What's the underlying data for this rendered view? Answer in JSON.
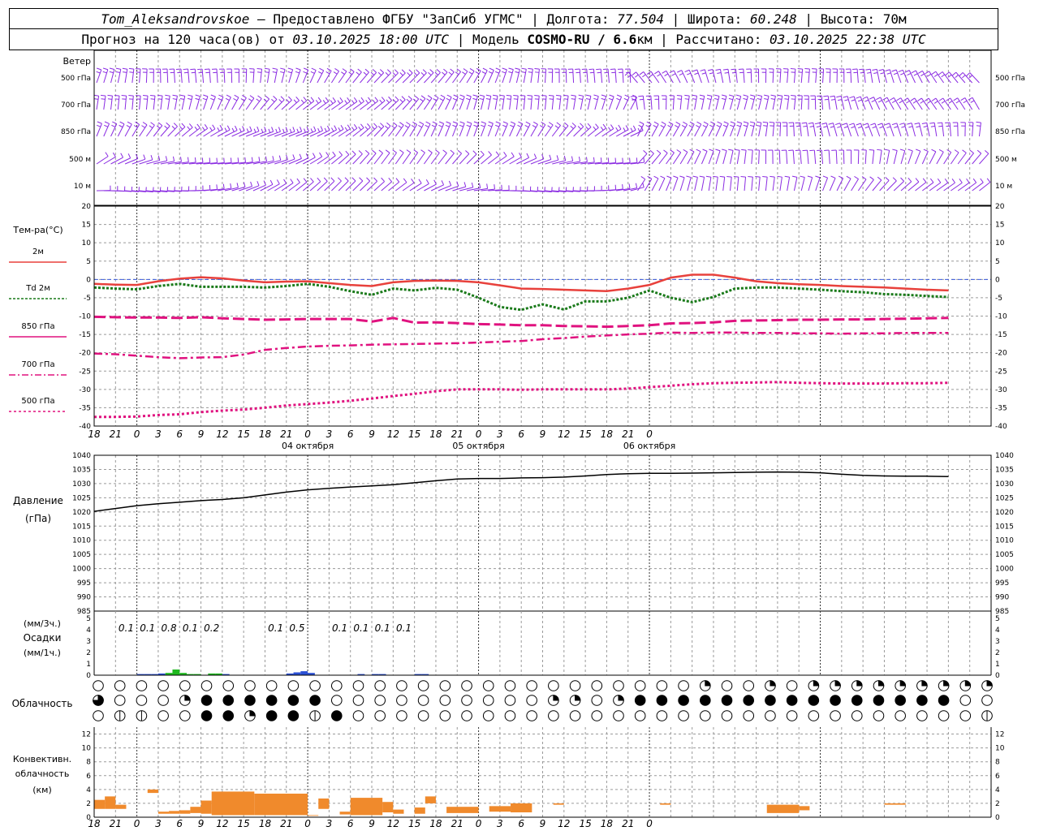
{
  "header": {
    "station": "Tom_Aleksandrovskoe",
    "provided_label": " — Предоставлено ФГБУ \"ЗапСиб УГМС\" | Долгота: ",
    "lon": "77.504",
    "lat_label": " | Широта: ",
    "lat": "60.248",
    "alt_label": " | Высота: 70м",
    "forecast_label": "Прогноз на 120 часа(ов) от ",
    "start": "03.10.2025 18:00 UTC",
    "model_label": " | Модель ",
    "model": "COSMO-RU / 6.6",
    "model_unit": "км",
    "calc_label": " | Рассчитано: ",
    "calc": "03.10.2025 22:38 UTC"
  },
  "chart_data": {
    "type": "meteogram",
    "hours": [
      0,
      3,
      6,
      9,
      12,
      15,
      18,
      21,
      24,
      27,
      30,
      33,
      36,
      39,
      42,
      45,
      48,
      51,
      54,
      57,
      60,
      63,
      66,
      69,
      72,
      75,
      78,
      81,
      84,
      87,
      90,
      93,
      96,
      99,
      102,
      105,
      108,
      111,
      114,
      117,
      120
    ],
    "time_ticks": [
      "18",
      "21",
      "0",
      "3",
      "6",
      "9",
      "12",
      "15",
      "18",
      "21",
      "0",
      "3",
      "6",
      "9",
      "12",
      "15",
      "18",
      "21",
      "0",
      "3",
      "6",
      "9",
      "12",
      "15",
      "18",
      "21",
      "0"
    ],
    "dates": [
      "04 октября",
      "05 октября",
      "06 октября"
    ],
    "colors": {
      "t2m": "#e8413c",
      "td": "#1a7a1a",
      "t850": "#e0127f",
      "t700": "#e0127f",
      "t500": "#e0127f",
      "wind": "#8a2be2",
      "pressure": "#000000",
      "precip_rain": "#2a4fd4",
      "precip_snow": "#1fb81f",
      "conv": "#f08a2c",
      "grid": "#9a9a9a"
    },
    "wind": {
      "label": "Ветер",
      "levels": [
        "500 гПа",
        "700 гПа",
        "850 гПа",
        "500 м",
        "10  м"
      ]
    },
    "temperature": {
      "ylabel": "Тем-ра(°C)",
      "ylim": [
        -40,
        20
      ],
      "yticks": [
        20,
        15,
        10,
        5,
        0,
        -5,
        -10,
        -15,
        -20,
        -25,
        -30,
        -35,
        -40
      ],
      "legend": [
        "2м",
        "Td  2м",
        "850 гПа",
        "700 гПа",
        "500 гПа"
      ],
      "t2m": [
        -1.2,
        -1.4,
        -1.5,
        -0.5,
        0.2,
        0.6,
        0.3,
        -0.3,
        -0.8,
        -0.6,
        -0.5,
        -1,
        -1.5,
        -1.8,
        -0.8,
        -0.4,
        -0.3,
        -0.4,
        -0.8,
        -1.6,
        -2.5,
        -2.6,
        -2.8,
        -3,
        -3.2,
        -2.5,
        -1.5,
        0.5,
        1.3,
        1.3,
        0.5,
        -0.5,
        -1,
        -1.3,
        -1.5,
        -1.8,
        -2,
        -2.2,
        -2.5,
        -2.8,
        -3
      ],
      "td": [
        -2.2,
        -2.5,
        -2.7,
        -1.8,
        -1.2,
        -2,
        -2,
        -2,
        -2.2,
        -1.8,
        -1.2,
        -2,
        -3.2,
        -4.2,
        -2.5,
        -3,
        -2.3,
        -2.8,
        -5,
        -7.5,
        -8.3,
        -6.8,
        -8.2,
        -6,
        -6,
        -5,
        -3,
        -5,
        -6.2,
        -4.8,
        -2.5,
        -2.2,
        -2.2,
        -2.5,
        -2.8,
        -3.2,
        -3.5,
        -4,
        -4.2,
        -4.5,
        -4.8
      ],
      "t850": [
        -10.2,
        -10.3,
        -10.4,
        -10.4,
        -10.5,
        -10.3,
        -10.6,
        -10.8,
        -11,
        -10.9,
        -10.8,
        -10.8,
        -10.8,
        -11.5,
        -10.5,
        -11.8,
        -11.7,
        -11.9,
        -12.2,
        -12.3,
        -12.5,
        -12.5,
        -12.7,
        -12.8,
        -12.9,
        -12.7,
        -12.5,
        -12,
        -11.9,
        -11.7,
        -11.3,
        -11.2,
        -11.1,
        -11,
        -11,
        -10.9,
        -10.9,
        -10.8,
        -10.7,
        -10.6,
        -10.5
      ],
      "t700": [
        -20.2,
        -20.4,
        -20.8,
        -21.2,
        -21.5,
        -21.3,
        -21.2,
        -20.5,
        -19.2,
        -18.7,
        -18.3,
        -18.1,
        -18,
        -17.8,
        -17.7,
        -17.6,
        -17.5,
        -17.4,
        -17.2,
        -17,
        -16.8,
        -16.3,
        -16,
        -15.6,
        -15.3,
        -15,
        -14.8,
        -14.5,
        -14.6,
        -14.5,
        -14.5,
        -14.6,
        -14.6,
        -14.7,
        -14.7,
        -14.8,
        -14.7,
        -14.7,
        -14.6,
        -14.6,
        -14.6
      ],
      "t500": [
        -37.5,
        -37.5,
        -37.4,
        -37,
        -36.8,
        -36.2,
        -35.8,
        -35.5,
        -35,
        -34.4,
        -34,
        -33.6,
        -33.1,
        -32.5,
        -31.8,
        -31.2,
        -30.5,
        -30,
        -30,
        -30,
        -30.1,
        -30,
        -30,
        -30,
        -30,
        -29.8,
        -29.4,
        -29,
        -28.6,
        -28.3,
        -28.2,
        -28.1,
        -28,
        -28.2,
        -28.3,
        -28.4,
        -28.4,
        -28.4,
        -28.3,
        -28.3,
        -28.2
      ]
    },
    "pressure": {
      "ylabel": [
        "Давление",
        "(гПа)"
      ],
      "ylim": [
        985,
        1040
      ],
      "yticks": [
        1040,
        1035,
        1030,
        1025,
        1020,
        1015,
        1010,
        1005,
        1000,
        995,
        990,
        985
      ],
      "values": [
        1020.2,
        1021.2,
        1022.2,
        1022.9,
        1023.4,
        1024,
        1024.4,
        1025,
        1026,
        1027,
        1027.8,
        1028.3,
        1028.8,
        1029.2,
        1029.6,
        1030.3,
        1031,
        1031.6,
        1031.8,
        1031.8,
        1032,
        1032.1,
        1032.3,
        1032.7,
        1033.2,
        1033.5,
        1033.6,
        1033.6,
        1033.7,
        1033.8,
        1033.9,
        1034,
        1034.1,
        1034,
        1033.8,
        1033.3,
        1032.9,
        1032.7,
        1032.6,
        1032.6,
        1032.5
      ]
    },
    "precipitation": {
      "ylabel": [
        "(мм/3ч.)",
        "Осадки",
        "(мм/1ч.)"
      ],
      "ylim": [
        0,
        5
      ],
      "yticks": [
        5,
        4,
        3,
        2,
        1,
        0
      ],
      "labels": [
        [
          "0.1",
          6
        ],
        [
          "0.1",
          9
        ],
        [
          "0.8",
          12
        ],
        [
          "0.1",
          15
        ],
        [
          "0.2",
          18
        ],
        [
          "0.1",
          27
        ],
        [
          "0.5",
          30
        ],
        [
          "0.1",
          36
        ],
        [
          "0.1",
          39
        ],
        [
          "0.1",
          42
        ],
        [
          "0.1",
          45
        ]
      ],
      "bars": [
        [
          6,
          0.1,
          "rain"
        ],
        [
          7,
          0.1,
          "rain"
        ],
        [
          8,
          0.1,
          "rain"
        ],
        [
          9,
          0.15,
          "rain"
        ],
        [
          10,
          0.2,
          "snow"
        ],
        [
          11,
          0.5,
          "snow"
        ],
        [
          12,
          0.2,
          "snow"
        ],
        [
          13,
          0.1,
          "snow"
        ],
        [
          14,
          0.1,
          "snow"
        ],
        [
          16,
          0.15,
          "snow"
        ],
        [
          17,
          0.15,
          "snow"
        ],
        [
          18,
          0.1,
          "rain"
        ],
        [
          27,
          0.15,
          "rain"
        ],
        [
          28,
          0.25,
          "rain"
        ],
        [
          29,
          0.35,
          "rain"
        ],
        [
          30,
          0.2,
          "rain"
        ],
        [
          37,
          0.1,
          "rain"
        ],
        [
          39,
          0.1,
          "rain"
        ],
        [
          40,
          0.1,
          "rain"
        ],
        [
          45,
          0.1,
          "rain"
        ],
        [
          46,
          0.1,
          "rain"
        ]
      ]
    },
    "cloudiness": {
      "ylabel": "Облачность",
      "rows": [
        "000000000000000000000000000000000000000000000000000000000000000000000000000000000000000000222600000222000022222222222222222222222222222222",
        "331030000022224444444444334444444440000000000000000000000000000000000222200022222444444444444444444444444444444444444444444444434210000000",
        "0111001240000444444444224444444212444400000000000000000000000000000000000000000000000000000000000000000000000000000000000000000000001100"
      ]
    },
    "convective": {
      "ylabel": [
        "Конвективн.",
        "облачность",
        "(км)"
      ],
      "ylim": [
        0,
        13
      ],
      "yticks": [
        12,
        10,
        8,
        6,
        4,
        2,
        0
      ],
      "blocks": [
        [
          0,
          1,
          1.2,
          2.5
        ],
        [
          1,
          2,
          1.2,
          3
        ],
        [
          2,
          3,
          1.2,
          1.8
        ],
        [
          5,
          6,
          3.5,
          4
        ],
        [
          6,
          7,
          0.5,
          0.8
        ],
        [
          7,
          8,
          0.5,
          0.9
        ],
        [
          8,
          9,
          0.5,
          1
        ],
        [
          9,
          10,
          0.6,
          1.5
        ],
        [
          10,
          11,
          0.5,
          2.4
        ],
        [
          11,
          15,
          0.3,
          3.7
        ],
        [
          15,
          20,
          0.3,
          3.4
        ],
        [
          20,
          21,
          0.2,
          0.3
        ],
        [
          21,
          22,
          1.2,
          2.7
        ],
        [
          23,
          24,
          0.4,
          0.8
        ],
        [
          24,
          27,
          0.3,
          2.8
        ],
        [
          27,
          28,
          0.7,
          2.2
        ],
        [
          28,
          29,
          0.5,
          1.1
        ],
        [
          30,
          31,
          0.5,
          1.4
        ],
        [
          31,
          32,
          2.0,
          3.0
        ],
        [
          33,
          36,
          0.6,
          1.5
        ],
        [
          37,
          39,
          0.8,
          1.6
        ],
        [
          39,
          41,
          0.7,
          2.0
        ],
        [
          43,
          44,
          1.8,
          2.0
        ],
        [
          53,
          54,
          1.8,
          2.0
        ],
        [
          63,
          66,
          0.6,
          1.8
        ],
        [
          66,
          67,
          1.0,
          1.6
        ],
        [
          74,
          76,
          1.8,
          2.0
        ]
      ]
    }
  }
}
